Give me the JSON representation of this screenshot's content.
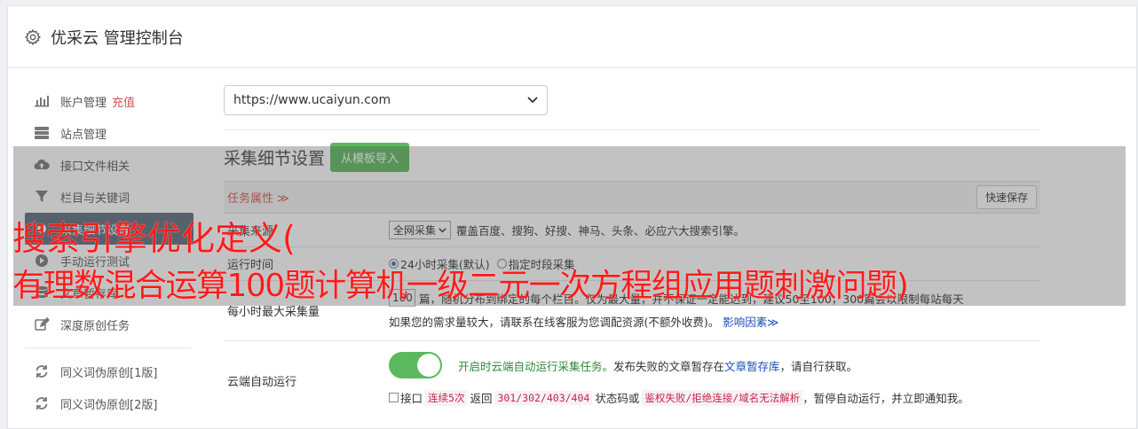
{
  "header": {
    "app_name": "优采云 管理控制台"
  },
  "sidebar": {
    "items": [
      {
        "label": "账户管理",
        "sub": "充值",
        "icon": "bar-chart-icon"
      },
      {
        "label": "站点管理",
        "icon": "server-icon"
      },
      {
        "label": "接口文件相关",
        "icon": "cloud-upload-icon"
      },
      {
        "label": "栏目与关键词",
        "icon": "filter-icon"
      },
      {
        "label": "采集细节设置",
        "icon": "settings-icon",
        "active": true
      },
      {
        "label": "手动运行测试",
        "icon": "play-icon"
      },
      {
        "label": "文章暂存库",
        "icon": "database-icon"
      },
      {
        "label": "深度原创任务",
        "icon": "edit-icon"
      },
      {
        "label": "同义词伪原创[1版]",
        "icon": "refresh-icon"
      },
      {
        "label": "同义词伪原创[2版]",
        "icon": "refresh-icon"
      }
    ]
  },
  "main": {
    "site_select": {
      "value": "https://www.ucaiyun.com"
    },
    "section_title": "采集细节设置",
    "import_button": "从模板导入",
    "panel_tab": "任务属性 ≫",
    "quick_save": "快速保存",
    "rows": {
      "source": {
        "label": "采集来源",
        "select": "全网采集",
        "desc": "覆盖百度、搜狗、好搜、神马、头条、必应六大搜索引擎。"
      },
      "run_time": {
        "label": "运行时间",
        "opt1": "24小时采集(默认)",
        "opt2": "指定时段采集"
      },
      "max_per_hour": {
        "label": "每小时最大采集量",
        "value": "100",
        "line1": "篇，随机分布到绑定的每个栏目。仅为最大量，并不保证一定能达到，建议50至100，300篇会以限制每站每天",
        "line2": "如果您的需求量较大，请联系在线客服为您调配资源(不额外收费)。",
        "link": "影响因素≫"
      },
      "cloud": {
        "label": "云端自动运行",
        "toggle_text": "开启时云端自动运行采集任务。",
        "text_a": "发布失败的文章暂存在",
        "link": "文章暂存库",
        "text_b": "，请自行获取。",
        "chk_pre": "接口",
        "code1": "连续5次",
        "mid1": "返回",
        "code2": "301/302/403/404",
        "mid2": "状态码或",
        "code3": "鉴权失败/拒绝连接/域名无法解析",
        "tail": "，暂停自动运行，并立即通知我。"
      }
    }
  },
  "overlay": {
    "line1": "搜索引擎优化定义(",
    "line2": "有理数混合运算100题计算机一级二元一次方程组应用题刺激问题)"
  }
}
